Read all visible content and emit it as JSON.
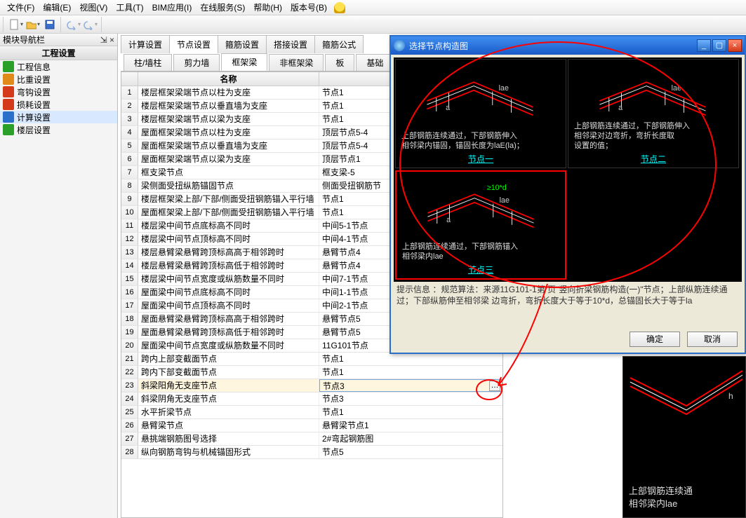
{
  "menu": {
    "items": [
      "文件(F)",
      "编辑(E)",
      "视图(V)",
      "工具(T)",
      "BIM应用(I)",
      "在线服务(S)",
      "帮助(H)",
      "版本号(B)"
    ]
  },
  "nav": {
    "panel_title": "模块导航栏",
    "pin_glyph": "⇲",
    "close_glyph": "×",
    "section": "工程设置",
    "items": [
      {
        "icon": "#2aa02a",
        "label": "工程信息"
      },
      {
        "icon": "#e08a1a",
        "label": "比重设置"
      },
      {
        "icon": "#d43a1a",
        "label": "弯钩设置"
      },
      {
        "icon": "#d43a1a",
        "label": "损耗设置"
      },
      {
        "icon": "#2a6fc9",
        "label": "计算设置"
      },
      {
        "icon": "#2aa02a",
        "label": "楼层设置"
      }
    ],
    "selected_index": 4
  },
  "main_tabs": [
    "计算设置",
    "节点设置",
    "箍筋设置",
    "搭接设置",
    "箍筋公式"
  ],
  "main_tab_active": 1,
  "sub_tabs": [
    "柱/墙柱",
    "剪力墙",
    "框架梁",
    "非框架梁",
    "板",
    "基础"
  ],
  "sub_tab_active": 2,
  "grid": {
    "headers": [
      "",
      "名称",
      ""
    ],
    "rows": [
      {
        "n": "1",
        "name": "楼层框架梁端节点以柱为支座",
        "val": "节点1"
      },
      {
        "n": "2",
        "name": "楼层框架梁端节点以垂直墙为支座",
        "val": "节点1"
      },
      {
        "n": "3",
        "name": "楼层框架梁端节点以梁为支座",
        "val": "节点1"
      },
      {
        "n": "4",
        "name": "屋面框架梁端节点以柱为支座",
        "val": "顶层节点5-4"
      },
      {
        "n": "5",
        "name": "屋面框架梁端节点以垂直墙为支座",
        "val": "顶层节点5-4"
      },
      {
        "n": "6",
        "name": "屋面框架梁端节点以梁为支座",
        "val": "顶层节点1"
      },
      {
        "n": "7",
        "name": "框支梁节点",
        "val": "框支梁-5"
      },
      {
        "n": "8",
        "name": "梁侧面受扭纵筋锚固节点",
        "val": "侧面受扭钢筋节"
      },
      {
        "n": "9",
        "name": "楼层框架梁上部/下部/侧面受扭钢筋锚入平行墙",
        "val": "节点1"
      },
      {
        "n": "10",
        "name": "屋面框架梁上部/下部/侧面受扭钢筋锚入平行墙",
        "val": "节点1"
      },
      {
        "n": "11",
        "name": "楼层梁中间节点底标高不同时",
        "val": "中间5-1节点"
      },
      {
        "n": "12",
        "name": "楼层梁中间节点顶标高不同时",
        "val": "中间4-1节点"
      },
      {
        "n": "13",
        "name": "楼层悬臂梁悬臂跨顶标高高于相邻跨时",
        "val": "悬臂节点4"
      },
      {
        "n": "14",
        "name": "楼层悬臂梁悬臂跨顶标高低于相邻跨时",
        "val": "悬臂节点4"
      },
      {
        "n": "15",
        "name": "楼层梁中间节点宽度或纵筋数量不同时",
        "val": "中间7-1节点"
      },
      {
        "n": "16",
        "name": "屋面梁中间节点底标高不同时",
        "val": "中间1-1节点"
      },
      {
        "n": "17",
        "name": "屋面梁中间节点顶标高不同时",
        "val": "中间2-1节点"
      },
      {
        "n": "18",
        "name": "屋面悬臂梁悬臂跨顶标高高于相邻跨时",
        "val": "悬臂节点5"
      },
      {
        "n": "19",
        "name": "屋面悬臂梁悬臂跨顶标高低于相邻跨时",
        "val": "悬臂节点5"
      },
      {
        "n": "20",
        "name": "屋面梁中间节点宽度或纵筋数量不同时",
        "val": "11G101节点"
      },
      {
        "n": "21",
        "name": "跨内上部变截面节点",
        "val": "节点1"
      },
      {
        "n": "22",
        "name": "跨内下部变截面节点",
        "val": "节点1"
      },
      {
        "n": "23",
        "name": "斜梁阳角无支座节点",
        "val": "节点3"
      },
      {
        "n": "24",
        "name": "斜梁阴角无支座节点",
        "val": "节点3"
      },
      {
        "n": "25",
        "name": "水平折梁节点",
        "val": "节点1"
      },
      {
        "n": "26",
        "name": "悬臂梁节点",
        "val": "悬臂梁节点1"
      },
      {
        "n": "27",
        "name": "悬挑端钢筋图号选择",
        "val": "2#弯起钢筋图"
      },
      {
        "n": "28",
        "name": "纵向钢筋弯钩与机械锚固形式",
        "val": "节点5"
      }
    ],
    "selected_row": 22
  },
  "dialog": {
    "title": "选择节点构造图",
    "thumbs": [
      {
        "label": "节点一",
        "desc": "上部钢筋连续通过，下部钢筋伸入\n相邻梁内锚固，锚固长度为laE(la)；"
      },
      {
        "label": "节点二",
        "desc": "上部钢筋连续通过，下部钢筋伸入\n相邻梁对边弯折，弯折长度取\n设置的值；"
      },
      {
        "label": "节点三",
        "desc": "上部钢筋连续通过，下部钢筋锚入\n相邻梁内lae",
        "dim": "≥10*d"
      }
    ],
    "selected_thumb": 2,
    "hint_label": "提示信息 ：",
    "hint_text": "规范算法：来源11G101-1第    页\"竖向折梁钢筋构造(一)\"节点；上部纵筋连续通过；下部纵筋伸至相邻梁    边弯折，弯折长度大于等于10*d，总锚固长大于等于la",
    "ok": "确定",
    "cancel": "取消"
  },
  "preview": {
    "desc": "上部钢筋连续通\n相邻梁内lae"
  }
}
